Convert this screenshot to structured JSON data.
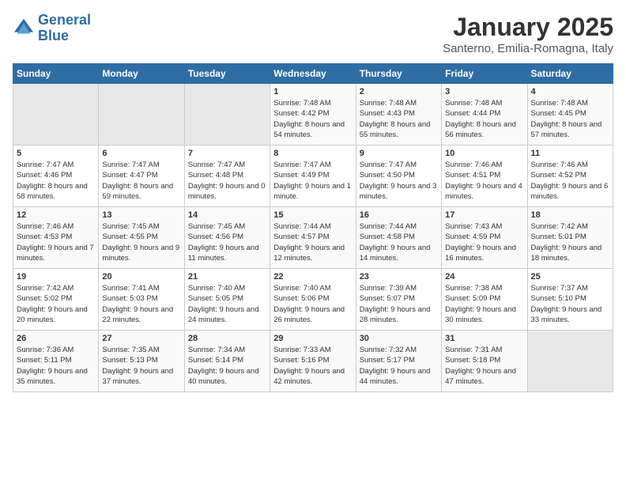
{
  "logo": {
    "line1": "General",
    "line2": "Blue"
  },
  "header": {
    "title": "January 2025",
    "subtitle": "Santerno, Emilia-Romagna, Italy"
  },
  "weekdays": [
    "Sunday",
    "Monday",
    "Tuesday",
    "Wednesday",
    "Thursday",
    "Friday",
    "Saturday"
  ],
  "weeks": [
    [
      {
        "day": "",
        "empty": true
      },
      {
        "day": "",
        "empty": true
      },
      {
        "day": "",
        "empty": true
      },
      {
        "day": "1",
        "sunrise": "7:48 AM",
        "sunset": "4:42 PM",
        "daylight": "8 hours and 54 minutes."
      },
      {
        "day": "2",
        "sunrise": "7:48 AM",
        "sunset": "4:43 PM",
        "daylight": "8 hours and 55 minutes."
      },
      {
        "day": "3",
        "sunrise": "7:48 AM",
        "sunset": "4:44 PM",
        "daylight": "8 hours and 56 minutes."
      },
      {
        "day": "4",
        "sunrise": "7:48 AM",
        "sunset": "4:45 PM",
        "daylight": "8 hours and 57 minutes."
      }
    ],
    [
      {
        "day": "5",
        "sunrise": "7:47 AM",
        "sunset": "4:46 PM",
        "daylight": "8 hours and 58 minutes."
      },
      {
        "day": "6",
        "sunrise": "7:47 AM",
        "sunset": "4:47 PM",
        "daylight": "8 hours and 59 minutes."
      },
      {
        "day": "7",
        "sunrise": "7:47 AM",
        "sunset": "4:48 PM",
        "daylight": "9 hours and 0 minutes."
      },
      {
        "day": "8",
        "sunrise": "7:47 AM",
        "sunset": "4:49 PM",
        "daylight": "9 hours and 1 minute."
      },
      {
        "day": "9",
        "sunrise": "7:47 AM",
        "sunset": "4:50 PM",
        "daylight": "9 hours and 3 minutes."
      },
      {
        "day": "10",
        "sunrise": "7:46 AM",
        "sunset": "4:51 PM",
        "daylight": "9 hours and 4 minutes."
      },
      {
        "day": "11",
        "sunrise": "7:46 AM",
        "sunset": "4:52 PM",
        "daylight": "9 hours and 6 minutes."
      }
    ],
    [
      {
        "day": "12",
        "sunrise": "7:46 AM",
        "sunset": "4:53 PM",
        "daylight": "9 hours and 7 minutes."
      },
      {
        "day": "13",
        "sunrise": "7:45 AM",
        "sunset": "4:55 PM",
        "daylight": "9 hours and 9 minutes."
      },
      {
        "day": "14",
        "sunrise": "7:45 AM",
        "sunset": "4:56 PM",
        "daylight": "9 hours and 11 minutes."
      },
      {
        "day": "15",
        "sunrise": "7:44 AM",
        "sunset": "4:57 PM",
        "daylight": "9 hours and 12 minutes."
      },
      {
        "day": "16",
        "sunrise": "7:44 AM",
        "sunset": "4:58 PM",
        "daylight": "9 hours and 14 minutes."
      },
      {
        "day": "17",
        "sunrise": "7:43 AM",
        "sunset": "4:59 PM",
        "daylight": "9 hours and 16 minutes."
      },
      {
        "day": "18",
        "sunrise": "7:42 AM",
        "sunset": "5:01 PM",
        "daylight": "9 hours and 18 minutes."
      }
    ],
    [
      {
        "day": "19",
        "sunrise": "7:42 AM",
        "sunset": "5:02 PM",
        "daylight": "9 hours and 20 minutes."
      },
      {
        "day": "20",
        "sunrise": "7:41 AM",
        "sunset": "5:03 PM",
        "daylight": "9 hours and 22 minutes."
      },
      {
        "day": "21",
        "sunrise": "7:40 AM",
        "sunset": "5:05 PM",
        "daylight": "9 hours and 24 minutes."
      },
      {
        "day": "22",
        "sunrise": "7:40 AM",
        "sunset": "5:06 PM",
        "daylight": "9 hours and 26 minutes."
      },
      {
        "day": "23",
        "sunrise": "7:39 AM",
        "sunset": "5:07 PM",
        "daylight": "9 hours and 28 minutes."
      },
      {
        "day": "24",
        "sunrise": "7:38 AM",
        "sunset": "5:09 PM",
        "daylight": "9 hours and 30 minutes."
      },
      {
        "day": "25",
        "sunrise": "7:37 AM",
        "sunset": "5:10 PM",
        "daylight": "9 hours and 33 minutes."
      }
    ],
    [
      {
        "day": "26",
        "sunrise": "7:36 AM",
        "sunset": "5:11 PM",
        "daylight": "9 hours and 35 minutes."
      },
      {
        "day": "27",
        "sunrise": "7:35 AM",
        "sunset": "5:13 PM",
        "daylight": "9 hours and 37 minutes."
      },
      {
        "day": "28",
        "sunrise": "7:34 AM",
        "sunset": "5:14 PM",
        "daylight": "9 hours and 40 minutes."
      },
      {
        "day": "29",
        "sunrise": "7:33 AM",
        "sunset": "5:16 PM",
        "daylight": "9 hours and 42 minutes."
      },
      {
        "day": "30",
        "sunrise": "7:32 AM",
        "sunset": "5:17 PM",
        "daylight": "9 hours and 44 minutes."
      },
      {
        "day": "31",
        "sunrise": "7:31 AM",
        "sunset": "5:18 PM",
        "daylight": "9 hours and 47 minutes."
      },
      {
        "day": "",
        "empty": true
      }
    ]
  ]
}
